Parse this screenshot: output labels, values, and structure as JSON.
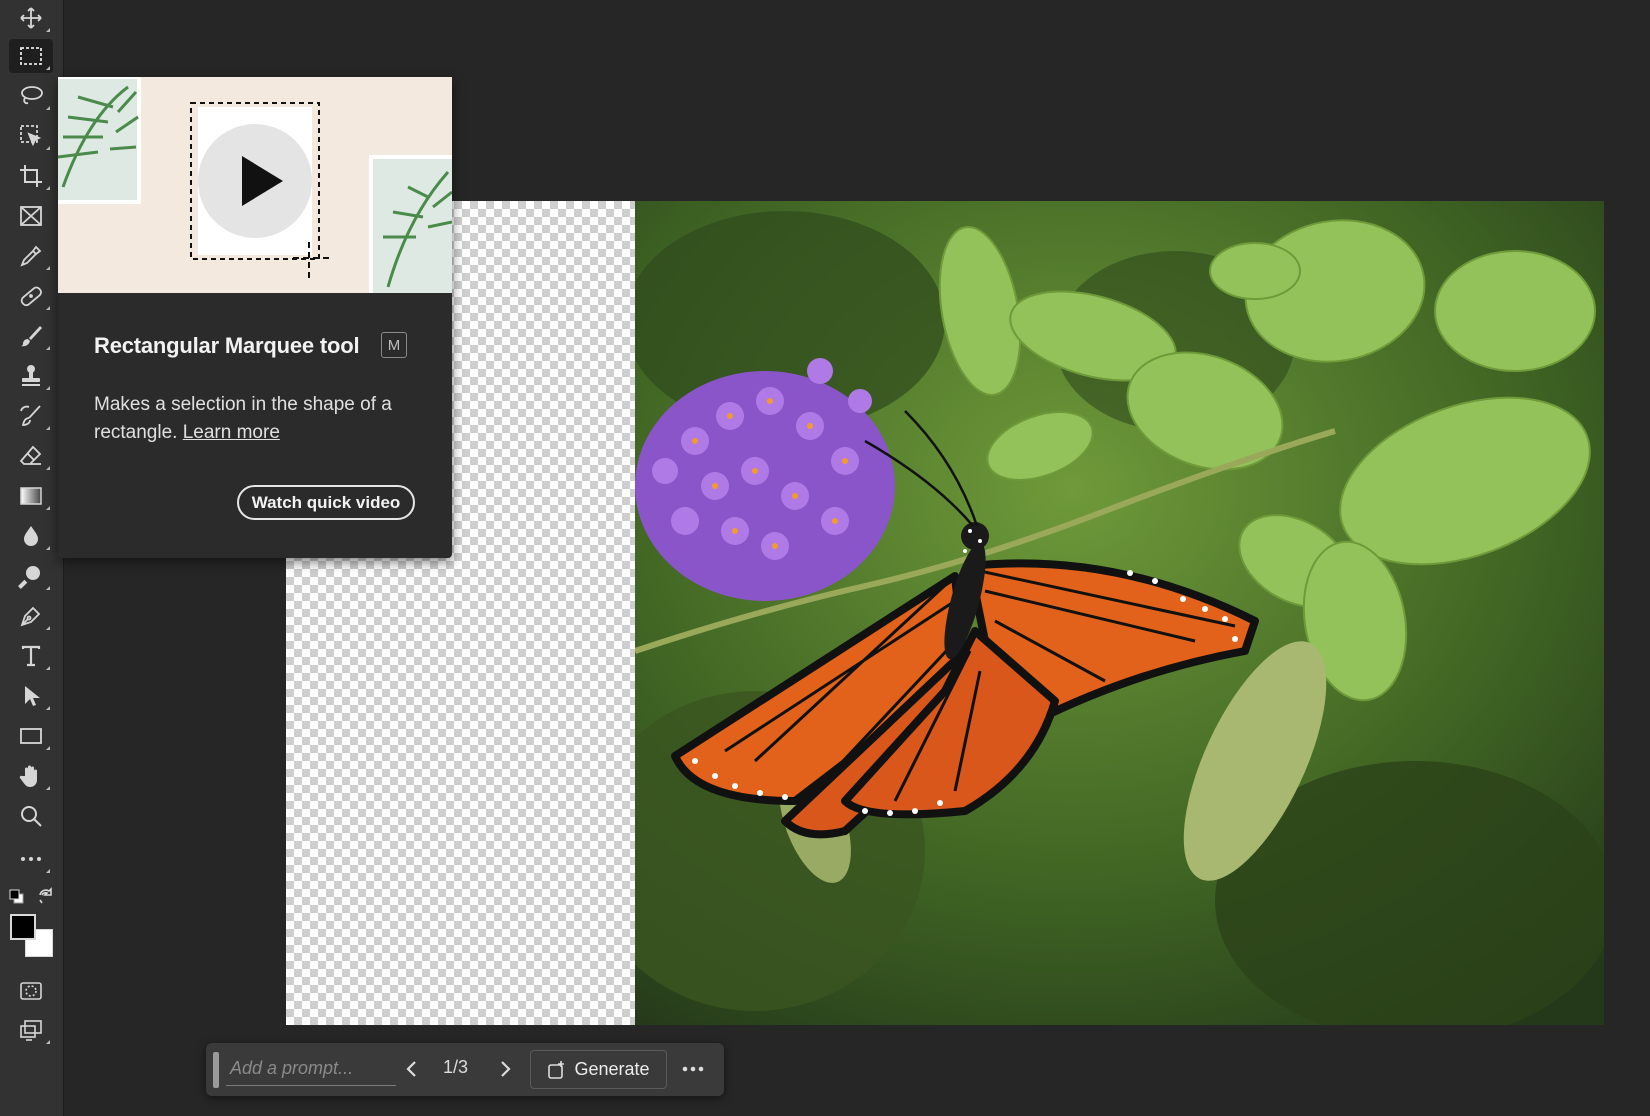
{
  "toolbar": {
    "tools": [
      {
        "name": "move-tool",
        "icon": "move-icon"
      },
      {
        "name": "rectangular-marquee-tool",
        "icon": "marquee-icon",
        "active": true
      },
      {
        "name": "lasso-tool",
        "icon": "lasso-icon"
      },
      {
        "name": "object-selection-tool",
        "icon": "object-select-icon"
      },
      {
        "name": "crop-tool",
        "icon": "crop-icon"
      },
      {
        "name": "frame-tool",
        "icon": "frame-icon"
      },
      {
        "name": "eyedropper-tool",
        "icon": "eyedropper-icon"
      },
      {
        "name": "healing-brush-tool",
        "icon": "bandage-icon"
      },
      {
        "name": "brush-tool",
        "icon": "brush-icon"
      },
      {
        "name": "clone-stamp-tool",
        "icon": "stamp-icon"
      },
      {
        "name": "history-brush-tool",
        "icon": "history-brush-icon"
      },
      {
        "name": "eraser-tool",
        "icon": "eraser-icon"
      },
      {
        "name": "gradient-tool",
        "icon": "gradient-icon"
      },
      {
        "name": "blur-tool",
        "icon": "drop-icon"
      },
      {
        "name": "dodge-tool",
        "icon": "dodge-icon"
      },
      {
        "name": "pen-tool",
        "icon": "pen-icon"
      },
      {
        "name": "type-tool",
        "icon": "type-icon"
      },
      {
        "name": "path-selection-tool",
        "icon": "arrow-icon"
      },
      {
        "name": "rectangle-tool",
        "icon": "rectangle-icon"
      },
      {
        "name": "hand-tool",
        "icon": "hand-icon"
      },
      {
        "name": "zoom-tool",
        "icon": "zoom-icon"
      },
      {
        "name": "edit-toolbar",
        "icon": "more-icon"
      }
    ],
    "foreground_color": "#000000",
    "background_color": "#ffffff"
  },
  "tooltip": {
    "title": "Rectangular Marquee tool",
    "shortcut": "M",
    "description": "Makes a selection in the shape of a rectangle.",
    "learn_more": "Learn more",
    "video_button": "Watch quick video"
  },
  "taskbar": {
    "prompt_placeholder": "Add a prompt...",
    "pager": "1/3",
    "generate_label": "Generate"
  },
  "colors": {
    "app_bg": "#262626",
    "panel": "#323232",
    "tooltip_bg": "#2b2b2b",
    "monarch_orange": "#e2621b"
  }
}
